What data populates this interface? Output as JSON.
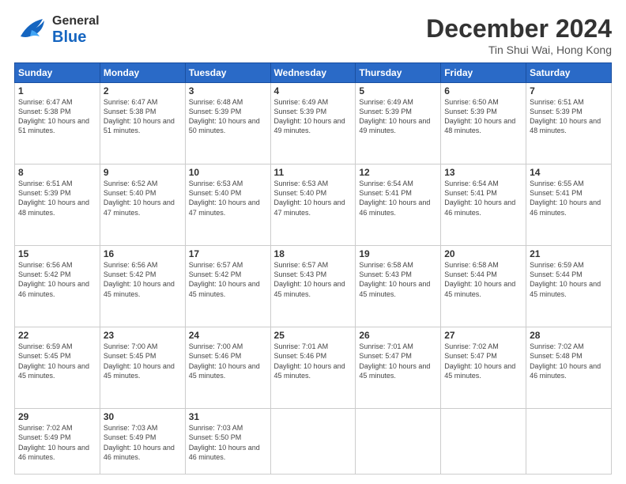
{
  "header": {
    "logo_general": "General",
    "logo_blue": "Blue",
    "month_title": "December 2024",
    "location": "Tin Shui Wai, Hong Kong"
  },
  "days_of_week": [
    "Sunday",
    "Monday",
    "Tuesday",
    "Wednesday",
    "Thursday",
    "Friday",
    "Saturday"
  ],
  "weeks": [
    [
      {
        "day": 1,
        "sunrise": "6:47 AM",
        "sunset": "5:38 PM",
        "daylight": "10 hours and 51 minutes."
      },
      {
        "day": 2,
        "sunrise": "6:47 AM",
        "sunset": "5:38 PM",
        "daylight": "10 hours and 51 minutes."
      },
      {
        "day": 3,
        "sunrise": "6:48 AM",
        "sunset": "5:39 PM",
        "daylight": "10 hours and 50 minutes."
      },
      {
        "day": 4,
        "sunrise": "6:49 AM",
        "sunset": "5:39 PM",
        "daylight": "10 hours and 49 minutes."
      },
      {
        "day": 5,
        "sunrise": "6:49 AM",
        "sunset": "5:39 PM",
        "daylight": "10 hours and 49 minutes."
      },
      {
        "day": 6,
        "sunrise": "6:50 AM",
        "sunset": "5:39 PM",
        "daylight": "10 hours and 48 minutes."
      },
      {
        "day": 7,
        "sunrise": "6:51 AM",
        "sunset": "5:39 PM",
        "daylight": "10 hours and 48 minutes."
      }
    ],
    [
      {
        "day": 8,
        "sunrise": "6:51 AM",
        "sunset": "5:39 PM",
        "daylight": "10 hours and 48 minutes."
      },
      {
        "day": 9,
        "sunrise": "6:52 AM",
        "sunset": "5:40 PM",
        "daylight": "10 hours and 47 minutes."
      },
      {
        "day": 10,
        "sunrise": "6:53 AM",
        "sunset": "5:40 PM",
        "daylight": "10 hours and 47 minutes."
      },
      {
        "day": 11,
        "sunrise": "6:53 AM",
        "sunset": "5:40 PM",
        "daylight": "10 hours and 47 minutes."
      },
      {
        "day": 12,
        "sunrise": "6:54 AM",
        "sunset": "5:41 PM",
        "daylight": "10 hours and 46 minutes."
      },
      {
        "day": 13,
        "sunrise": "6:54 AM",
        "sunset": "5:41 PM",
        "daylight": "10 hours and 46 minutes."
      },
      {
        "day": 14,
        "sunrise": "6:55 AM",
        "sunset": "5:41 PM",
        "daylight": "10 hours and 46 minutes."
      }
    ],
    [
      {
        "day": 15,
        "sunrise": "6:56 AM",
        "sunset": "5:42 PM",
        "daylight": "10 hours and 46 minutes."
      },
      {
        "day": 16,
        "sunrise": "6:56 AM",
        "sunset": "5:42 PM",
        "daylight": "10 hours and 45 minutes."
      },
      {
        "day": 17,
        "sunrise": "6:57 AM",
        "sunset": "5:42 PM",
        "daylight": "10 hours and 45 minutes."
      },
      {
        "day": 18,
        "sunrise": "6:57 AM",
        "sunset": "5:43 PM",
        "daylight": "10 hours and 45 minutes."
      },
      {
        "day": 19,
        "sunrise": "6:58 AM",
        "sunset": "5:43 PM",
        "daylight": "10 hours and 45 minutes."
      },
      {
        "day": 20,
        "sunrise": "6:58 AM",
        "sunset": "5:44 PM",
        "daylight": "10 hours and 45 minutes."
      },
      {
        "day": 21,
        "sunrise": "6:59 AM",
        "sunset": "5:44 PM",
        "daylight": "10 hours and 45 minutes."
      }
    ],
    [
      {
        "day": 22,
        "sunrise": "6:59 AM",
        "sunset": "5:45 PM",
        "daylight": "10 hours and 45 minutes."
      },
      {
        "day": 23,
        "sunrise": "7:00 AM",
        "sunset": "5:45 PM",
        "daylight": "10 hours and 45 minutes."
      },
      {
        "day": 24,
        "sunrise": "7:00 AM",
        "sunset": "5:46 PM",
        "daylight": "10 hours and 45 minutes."
      },
      {
        "day": 25,
        "sunrise": "7:01 AM",
        "sunset": "5:46 PM",
        "daylight": "10 hours and 45 minutes."
      },
      {
        "day": 26,
        "sunrise": "7:01 AM",
        "sunset": "5:47 PM",
        "daylight": "10 hours and 45 minutes."
      },
      {
        "day": 27,
        "sunrise": "7:02 AM",
        "sunset": "5:47 PM",
        "daylight": "10 hours and 45 minutes."
      },
      {
        "day": 28,
        "sunrise": "7:02 AM",
        "sunset": "5:48 PM",
        "daylight": "10 hours and 46 minutes."
      }
    ],
    [
      {
        "day": 29,
        "sunrise": "7:02 AM",
        "sunset": "5:49 PM",
        "daylight": "10 hours and 46 minutes."
      },
      {
        "day": 30,
        "sunrise": "7:03 AM",
        "sunset": "5:49 PM",
        "daylight": "10 hours and 46 minutes."
      },
      {
        "day": 31,
        "sunrise": "7:03 AM",
        "sunset": "5:50 PM",
        "daylight": "10 hours and 46 minutes."
      },
      null,
      null,
      null,
      null
    ]
  ]
}
